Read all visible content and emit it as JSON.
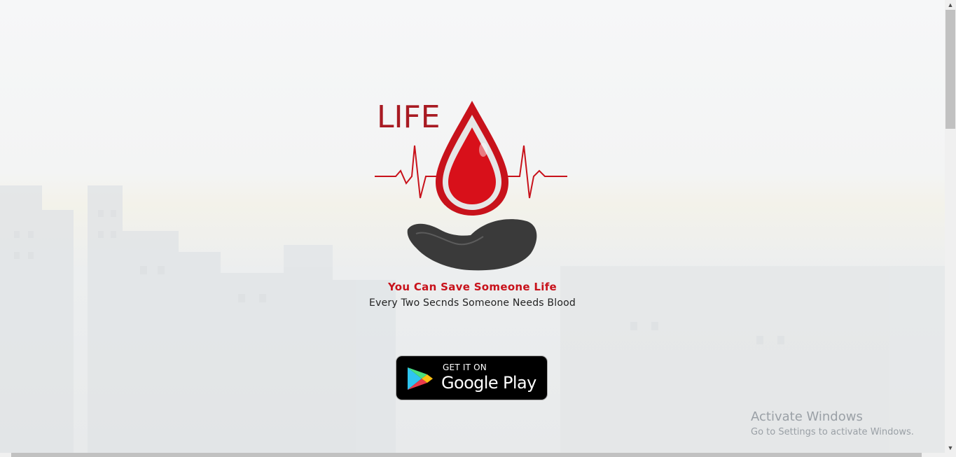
{
  "brand": {
    "logo_text": "LIFE",
    "accent_color": "#c8121b"
  },
  "hero": {
    "headline": "You Can Save Someone Life",
    "subline": "Every Two Secnds Someone Needs Blood"
  },
  "store_badge": {
    "small_text": "GET IT ON",
    "big_text": "Google Play"
  },
  "watermark": {
    "title": "Activate Windows",
    "subtitle": "Go to Settings to activate Windows."
  },
  "icons": [
    "blood-drop-icon",
    "heartbeat-line-icon",
    "hand-icon",
    "google-play-icon",
    "scroll-up-arrow-icon",
    "scroll-down-arrow-icon"
  ]
}
